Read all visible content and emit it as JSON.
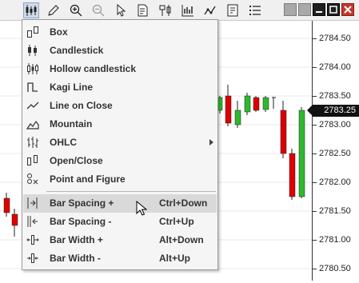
{
  "toolbar": {
    "buttons": [
      "chart-style-icon",
      "draw-pencil-icon",
      "zoom-in-icon",
      "zoom-out-icon",
      "select-pointer-icon",
      "properties-icon",
      "data-box-icon",
      "indicators-icon",
      "strategies-icon",
      "templates-icon",
      "instruments-list-icon"
    ],
    "active": "chart-style-icon"
  },
  "price_axis": {
    "ticks": [
      "2784.50",
      "2784.00",
      "2783.50",
      "2783.00",
      "2782.50",
      "2782.00",
      "2781.50",
      "2781.00",
      "2780.50"
    ],
    "current_price": "2783.25"
  },
  "colors": {
    "up": "#2eb82e",
    "down": "#dd0000",
    "marker": "#111111"
  },
  "menu": {
    "items": [
      {
        "label": "Box",
        "icon": "box-icon"
      },
      {
        "label": "Candlestick",
        "icon": "candlestick-icon"
      },
      {
        "label": "Hollow candlestick",
        "icon": "hollow-candlestick-icon"
      },
      {
        "label": "Kagi Line",
        "icon": "kagi-line-icon"
      },
      {
        "label": "Line on Close",
        "icon": "line-on-close-icon"
      },
      {
        "label": "Mountain",
        "icon": "mountain-icon"
      },
      {
        "label": "OHLC",
        "icon": "ohlc-icon",
        "submenu": true
      },
      {
        "label": "Open/Close",
        "icon": "open-close-icon"
      },
      {
        "label": "Point and Figure",
        "icon": "point-and-figure-icon"
      }
    ],
    "actions": [
      {
        "label": "Bar Spacing +",
        "shortcut": "Ctrl+Down",
        "icon": "bar-spacing-increase-icon",
        "highlighted": true
      },
      {
        "label": "Bar Spacing -",
        "shortcut": "Ctrl+Up",
        "icon": "bar-spacing-decrease-icon"
      },
      {
        "label": "Bar Width +",
        "shortcut": "Alt+Down",
        "icon": "bar-width-increase-icon"
      },
      {
        "label": "Bar Width -",
        "shortcut": "Alt+Up",
        "icon": "bar-width-decrease-icon"
      }
    ]
  }
}
